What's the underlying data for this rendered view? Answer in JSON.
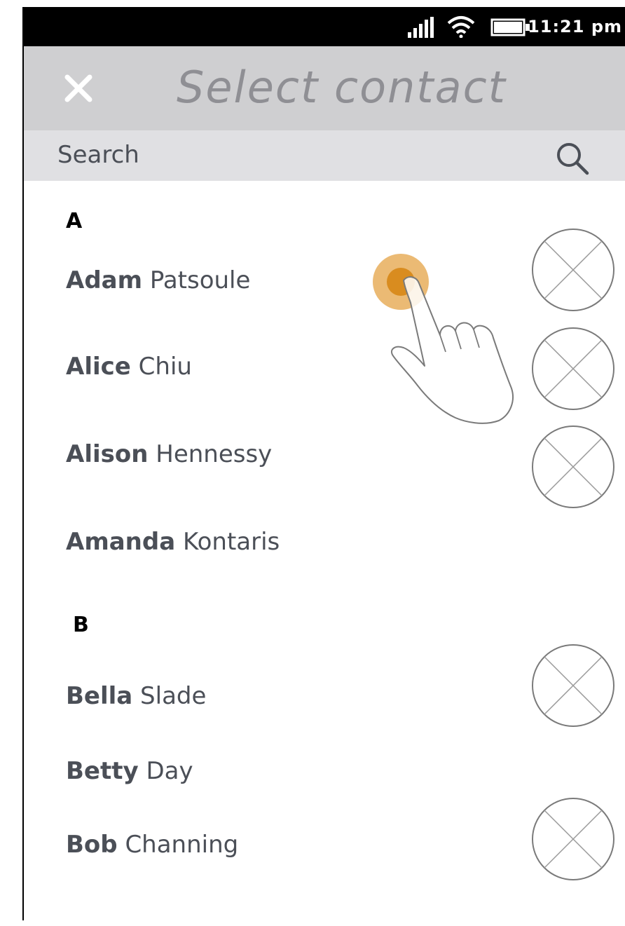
{
  "status_bar": {
    "time": "11:21 pm",
    "icons": [
      "signal-icon",
      "wifi-icon",
      "battery-icon"
    ]
  },
  "header": {
    "title": "Select contact",
    "close_icon": "close-icon"
  },
  "search": {
    "placeholder": "Search",
    "icon": "search-icon"
  },
  "sections": [
    {
      "letter": "A",
      "contacts": [
        {
          "first": "Adam",
          "last": "Patsoule",
          "avatar": true
        },
        {
          "first": "Alice",
          "last": "Chiu",
          "avatar": true
        },
        {
          "first": "Alison",
          "last": "Hennessy",
          "avatar": true
        },
        {
          "first": "Amanda",
          "last": "Kontaris",
          "avatar": false
        }
      ]
    },
    {
      "letter": "B",
      "contacts": [
        {
          "first": "Bella",
          "last": "Slade",
          "avatar": true
        },
        {
          "first": "Betty",
          "last": "Day",
          "avatar": false
        },
        {
          "first": "Bob",
          "last": "Channing",
          "avatar": true
        }
      ]
    }
  ],
  "colors": {
    "header_bg": "#cfcfd1",
    "search_bg": "#e0e0e3",
    "text": "#4b4f57",
    "title": "#8f8f94",
    "touch_accent": "#e0952a"
  }
}
